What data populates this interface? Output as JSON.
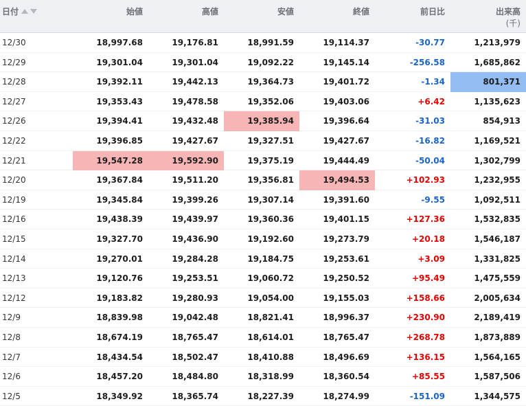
{
  "headers": {
    "date": "日付",
    "open": "始値",
    "high": "高値",
    "low": "安値",
    "close": "終値",
    "change": "前日比",
    "volume": "出来高",
    "volume_unit": "(千)"
  },
  "colors": {
    "positive": "#e60000",
    "negative": "#1a64c8",
    "highlight_red": "#f7b5b5",
    "highlight_blue": "#94bdf4"
  },
  "rows": [
    {
      "date": "12/30",
      "open": "18,997.68",
      "high": "19,176.81",
      "low": "18,991.59",
      "close": "19,114.37",
      "change": "-30.77",
      "volume": "1,213,979"
    },
    {
      "date": "12/29",
      "open": "19,301.04",
      "high": "19,301.04",
      "low": "19,092.22",
      "close": "19,145.14",
      "change": "-256.58",
      "volume": "1,685,862"
    },
    {
      "date": "12/28",
      "open": "19,392.11",
      "high": "19,442.13",
      "low": "19,364.73",
      "close": "19,401.72",
      "change": "-1.34",
      "volume": "801,371"
    },
    {
      "date": "12/27",
      "open": "19,353.43",
      "high": "19,478.58",
      "low": "19,352.06",
      "close": "19,403.06",
      "change": "+6.42",
      "volume": "1,135,623"
    },
    {
      "date": "12/26",
      "open": "19,394.41",
      "high": "19,432.48",
      "low": "19,385.94",
      "close": "19,396.64",
      "change": "-31.03",
      "volume": "854,913"
    },
    {
      "date": "12/22",
      "open": "19,396.85",
      "high": "19,427.67",
      "low": "19,327.51",
      "close": "19,427.67",
      "change": "-16.82",
      "volume": "1,169,521"
    },
    {
      "date": "12/21",
      "open": "19,547.28",
      "high": "19,592.90",
      "low": "19,375.19",
      "close": "19,444.49",
      "change": "-50.04",
      "volume": "1,302,799"
    },
    {
      "date": "12/20",
      "open": "19,367.84",
      "high": "19,511.20",
      "low": "19,356.81",
      "close": "19,494.53",
      "change": "+102.93",
      "volume": "1,232,955"
    },
    {
      "date": "12/19",
      "open": "19,345.84",
      "high": "19,399.26",
      "low": "19,307.14",
      "close": "19,391.60",
      "change": "-9.55",
      "volume": "1,092,511"
    },
    {
      "date": "12/16",
      "open": "19,438.39",
      "high": "19,439.97",
      "low": "19,360.36",
      "close": "19,401.15",
      "change": "+127.36",
      "volume": "1,532,835"
    },
    {
      "date": "12/15",
      "open": "19,327.70",
      "high": "19,436.90",
      "low": "19,192.60",
      "close": "19,273.79",
      "change": "+20.18",
      "volume": "1,546,187"
    },
    {
      "date": "12/14",
      "open": "19,270.01",
      "high": "19,284.28",
      "low": "19,184.75",
      "close": "19,253.61",
      "change": "+3.09",
      "volume": "1,331,825"
    },
    {
      "date": "12/13",
      "open": "19,120.76",
      "high": "19,253.51",
      "low": "19,060.72",
      "close": "19,250.52",
      "change": "+95.49",
      "volume": "1,475,559"
    },
    {
      "date": "12/12",
      "open": "19,183.82",
      "high": "19,280.93",
      "low": "19,054.00",
      "close": "19,155.03",
      "change": "+158.66",
      "volume": "2,005,634"
    },
    {
      "date": "12/9",
      "open": "18,839.98",
      "high": "19,042.48",
      "low": "18,821.41",
      "close": "18,996.37",
      "change": "+230.90",
      "volume": "2,189,419"
    },
    {
      "date": "12/8",
      "open": "18,674.19",
      "high": "18,765.47",
      "low": "18,614.01",
      "close": "18,765.47",
      "change": "+268.78",
      "volume": "1,873,889"
    },
    {
      "date": "12/7",
      "open": "18,434.54",
      "high": "18,502.47",
      "low": "18,410.88",
      "close": "18,496.69",
      "change": "+136.15",
      "volume": "1,564,165"
    },
    {
      "date": "12/6",
      "open": "18,457.20",
      "high": "18,484.80",
      "low": "18,318.99",
      "close": "18,360.54",
      "change": "+85.55",
      "volume": "1,587,506"
    },
    {
      "date": "12/5",
      "open": "18,349.92",
      "high": "18,365.74",
      "low": "18,227.39",
      "close": "18,274.99",
      "change": "-151.09",
      "volume": "1,344,575"
    }
  ]
}
